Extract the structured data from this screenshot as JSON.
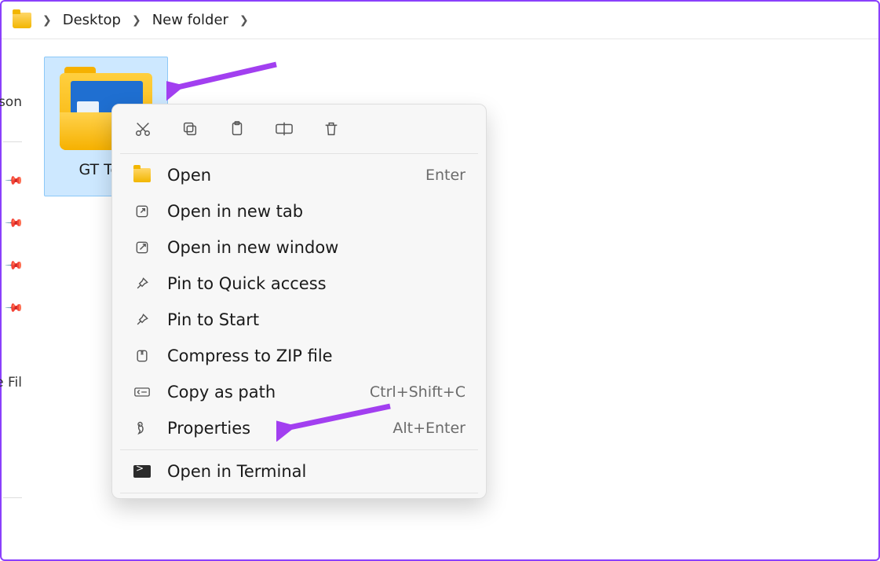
{
  "breadcrumb": {
    "items": [
      "Desktop",
      "New folder"
    ]
  },
  "sidebar": {
    "label_top": "son",
    "label_mid": "e Fil"
  },
  "folder": {
    "name": "GT Test"
  },
  "context_menu": {
    "toolbar": {
      "cut": "cut-icon",
      "copy": "copy-icon",
      "paste": "paste-icon",
      "rename": "rename-icon",
      "delete": "delete-icon"
    },
    "items": [
      {
        "icon": "folder",
        "label": "Open",
        "shortcut": "Enter"
      },
      {
        "icon": "open-tab",
        "label": "Open in new tab",
        "shortcut": ""
      },
      {
        "icon": "open-window",
        "label": "Open in new window",
        "shortcut": ""
      },
      {
        "icon": "pin",
        "label": "Pin to Quick access",
        "shortcut": ""
      },
      {
        "icon": "pin",
        "label": "Pin to Start",
        "shortcut": ""
      },
      {
        "icon": "zip",
        "label": "Compress to ZIP file",
        "shortcut": ""
      },
      {
        "icon": "copy-path",
        "label": "Copy as path",
        "shortcut": "Ctrl+Shift+C"
      },
      {
        "icon": "properties",
        "label": "Properties",
        "shortcut": "Alt+Enter"
      }
    ],
    "terminal": {
      "label": "Open in Terminal"
    }
  },
  "colors": {
    "selection_bg": "#cde8ff",
    "selection_border": "#8cc8f7",
    "folder_yellow": "#f6b100",
    "arrow_purple": "#a23ff0",
    "outer_border": "#8a3ffc"
  }
}
